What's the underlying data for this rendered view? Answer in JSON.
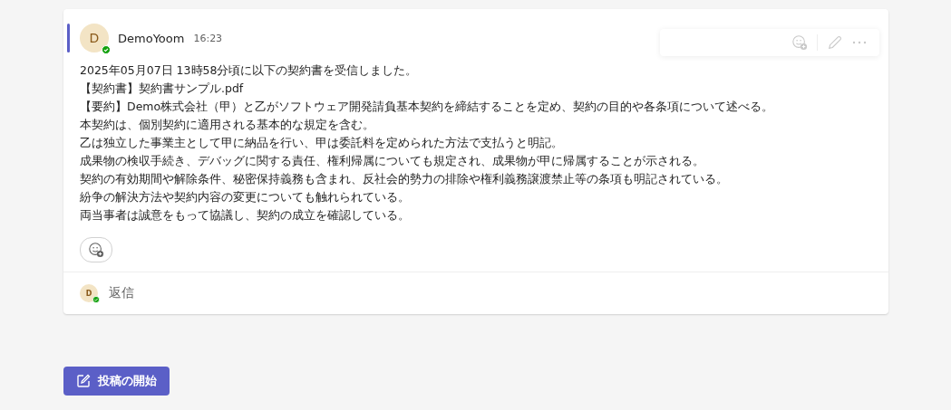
{
  "message": {
    "avatar_initial": "D",
    "author": "DemoYoom",
    "time": "16:23",
    "lines": [
      "2025年05月07日 13時58分頃に以下の契約書を受信しました。",
      "【契約書】契約書サンプル.pdf",
      "【要約】Demo株式会社（甲）と乙がソフトウェア開発請負基本契約を締結することを定め、契約の目的や各条項について述べる。",
      "本契約は、個別契約に適用される基本的な規定を含む。",
      "乙は独立した事業主として甲に納品を行い、甲は委託料を定められた方法で支払うと明記。",
      "成果物の検収手続き、デバッグに関する責任、権利帰属についても規定され、成果物が甲に帰属することが示される。",
      "契約の有効期間や解除条件、秘密保持義務も含まれ、反社会的勢力の排除や権利義務譲渡禁止等の条項も明記されている。",
      "紛争の解決方法や契約内容の変更についても触れられている。",
      "両当事者は誠意をもって協議し、契約の成立を確認している。"
    ]
  },
  "reply": {
    "avatar_initial": "D",
    "label": "返信"
  },
  "new_post_button": "投稿の開始"
}
